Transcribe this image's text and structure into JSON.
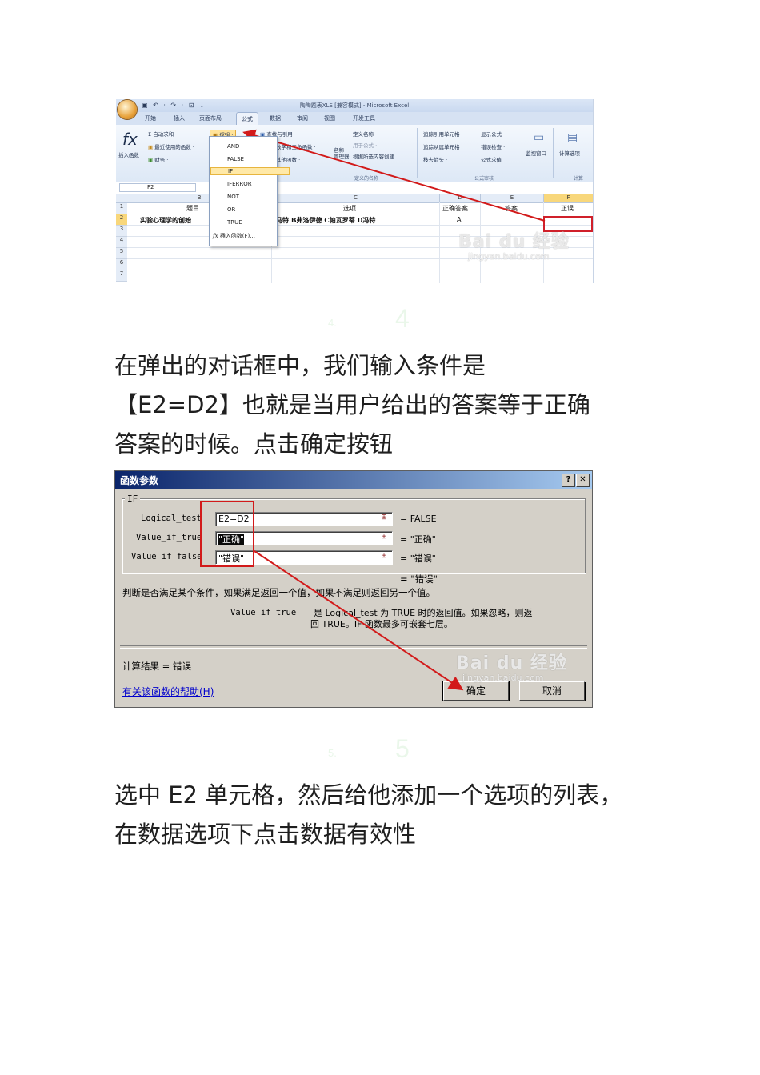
{
  "excel": {
    "window_title": "陶陶题表XLS [兼容模式] - Microsoft Excel",
    "quick_access": "▣ ↶ · ↷ · ⊡ ⇣",
    "tabs": [
      "开始",
      "插入",
      "页面布局",
      "公式",
      "数据",
      "审阅",
      "视图",
      "开发工具"
    ],
    "active_tab": "公式",
    "ribbon": {
      "insert_function": "插入函数",
      "autosum": "Σ 自动求和 ·",
      "recent": "最近使用的函数 ·",
      "financial": "财务 ·",
      "logical": "逻辑 ·",
      "lookup": "查找与引用 ·",
      "math": "数学和三角函数 ·",
      "other": "其他函数 ·",
      "name_manager": "名称\n管理器",
      "define_name": "定义名称 ·",
      "use_in_formula": "用于公式 ·",
      "create_from_selection": "根据所选内容创建",
      "defined_names_group": "定义的名称",
      "trace_precedents": "追踪引用单元格",
      "trace_dependents": "追踪从属单元格",
      "remove_arrows": "移去箭头 ·",
      "show_formulas": "显示公式",
      "error_checking": "错误检查 ·",
      "evaluate_formula": "公式求值",
      "formula_auditing_group": "公式审核",
      "watch_window": "监视窗口",
      "calc_options": "计算选项",
      "calc_group": "计算"
    },
    "logical_menu": [
      "AND",
      "FALSE",
      "IF",
      "IFERROR",
      "NOT",
      "OR",
      "TRUE",
      "插入函数(F)..."
    ],
    "logical_menu_selected": "IF",
    "name_box": "F2",
    "columns": [
      "B",
      "C",
      "D",
      "E",
      "F"
    ],
    "rows": [
      "1",
      "2",
      "3",
      "4",
      "5",
      "6",
      "7"
    ],
    "row1": {
      "b": "题目",
      "c": "选项",
      "d": "正确答案",
      "e": "答案",
      "f": "正误"
    },
    "row2": {
      "b": "实验心理学的创始",
      "c": "马特  B弗洛伊德  C帕瓦罗蒂  D冯特",
      "d": "A"
    }
  },
  "step4": {
    "number": "4",
    "number_small": "4."
  },
  "paragraph_1": {
    "lines": [
      "在弹出的对话框中，我们输入条件是",
      "【E2=D2】也就是当用户给出的答案等于正确",
      "答案的时候。点击确定按钮"
    ]
  },
  "dialog": {
    "title": "函数参数",
    "help_btn": "?",
    "close_btn": "✕",
    "group": "IF",
    "args": [
      {
        "label": "Logical_test",
        "value": "E2=D2",
        "result": "= FALSE"
      },
      {
        "label": "Value_if_true",
        "value": "\"正确\"",
        "result": "= \"正确\""
      },
      {
        "label": "Value_if_false",
        "value": "\"错误\"",
        "result": "= \"错误\""
      }
    ],
    "formula_result_preview": "= \"错误\"",
    "description": "判断是否满足某个条件，如果满足返回一个值，如果不满足则返回另一个值。",
    "param_name": "Value_if_true",
    "param_desc_1": "是 Logical_test 为 TRUE 时的返回值。如果忽略，则返",
    "param_desc_2": "回 TRUE。IF 函数最多可嵌套七层。",
    "calc_result": "计算结果 =  错误",
    "help_link": "有关该函数的帮助(H)",
    "ok": "确定",
    "cancel": "取消"
  },
  "step5": {
    "number": "5",
    "number_small": "5."
  },
  "paragraph_2": {
    "lines": [
      "选中 E2 单元格，然后给他添加一个选项的列表，",
      "在数据选项下点击数据有效性"
    ]
  },
  "watermark": {
    "logo": "Bai du 经验",
    "url": "jingyan.baidu.com"
  },
  "colors": {
    "annotation_red": "#d21a1a",
    "title_bar": "#0a246a",
    "dialog_bg": "#d4d0c8"
  }
}
